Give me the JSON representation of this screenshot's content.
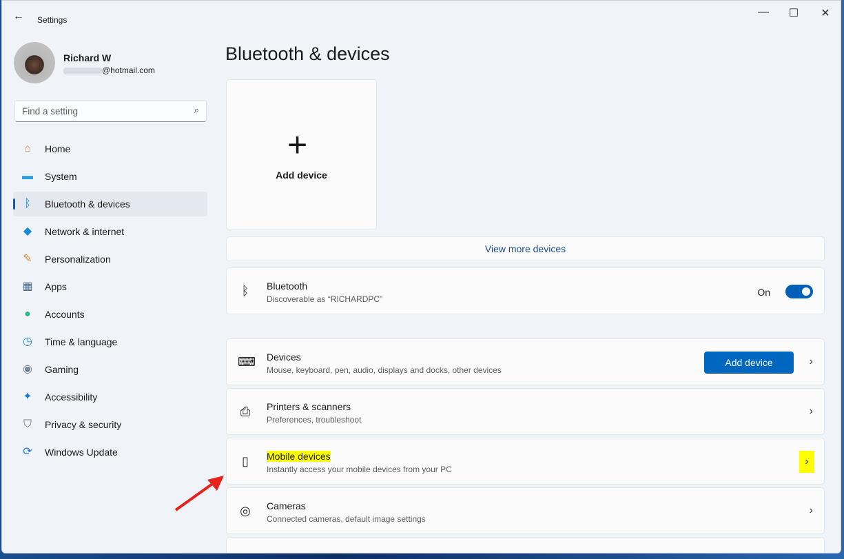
{
  "window": {
    "title": "Settings",
    "minimize": "—",
    "maximize": "☐",
    "close": "✕",
    "back": "←"
  },
  "user": {
    "name": "Richard W",
    "email_suffix": "@hotmail.com"
  },
  "search": {
    "placeholder": "Find a setting",
    "icon": "⌕"
  },
  "nav": [
    {
      "label": "Home",
      "icon": "home-icon",
      "glyph": "⌂",
      "color": "#e8744a"
    },
    {
      "label": "System",
      "icon": "system-icon",
      "glyph": "▬",
      "color": "#2b9fd9"
    },
    {
      "label": "Bluetooth & devices",
      "icon": "bluetooth-icon",
      "glyph": "ᛒ",
      "color": "#1a78d6",
      "active": true
    },
    {
      "label": "Network & internet",
      "icon": "wifi-icon",
      "glyph": "◆",
      "color": "#1a8ad6"
    },
    {
      "label": "Personalization",
      "icon": "brush-icon",
      "glyph": "✎",
      "color": "#d08a3a"
    },
    {
      "label": "Apps",
      "icon": "apps-icon",
      "glyph": "▦",
      "color": "#4a6a8a"
    },
    {
      "label": "Accounts",
      "icon": "accounts-icon",
      "glyph": "●",
      "color": "#2eb88a"
    },
    {
      "label": "Time & language",
      "icon": "globe-icon",
      "glyph": "◷",
      "color": "#2b8ad6"
    },
    {
      "label": "Gaming",
      "icon": "gamepad-icon",
      "glyph": "◉",
      "color": "#7a8594"
    },
    {
      "label": "Accessibility",
      "icon": "accessibility-icon",
      "glyph": "✦",
      "color": "#1a78d6"
    },
    {
      "label": "Privacy & security",
      "icon": "shield-icon",
      "glyph": "⛉",
      "color": "#6a7480"
    },
    {
      "label": "Windows Update",
      "icon": "update-icon",
      "glyph": "⟳",
      "color": "#1a78d6"
    }
  ],
  "main": {
    "title": "Bluetooth & devices",
    "add_tile": {
      "plus": "+",
      "label": "Add device"
    },
    "view_more": "View more devices",
    "bluetooth": {
      "title": "Bluetooth",
      "subtitle": "Discoverable as “RICHARDPC”",
      "state": "On",
      "on": true
    },
    "rows": [
      {
        "title": "Devices",
        "subtitle": "Mouse, keyboard, pen, audio, displays and docks, other devices",
        "button": "Add device",
        "glyph": "⌨"
      },
      {
        "title": "Printers & scanners",
        "subtitle": "Preferences, troubleshoot",
        "glyph": "⎙"
      },
      {
        "title": "Mobile devices",
        "subtitle": "Instantly access your mobile devices from your PC",
        "glyph": "▯",
        "highlight": true
      },
      {
        "title": "Cameras",
        "subtitle": "Connected cameras, default image settings",
        "glyph": "◎"
      }
    ],
    "chevron": "›"
  },
  "colors": {
    "accent": "#005fb8",
    "highlight": "#ffff00",
    "arrow": "#e8211a"
  }
}
